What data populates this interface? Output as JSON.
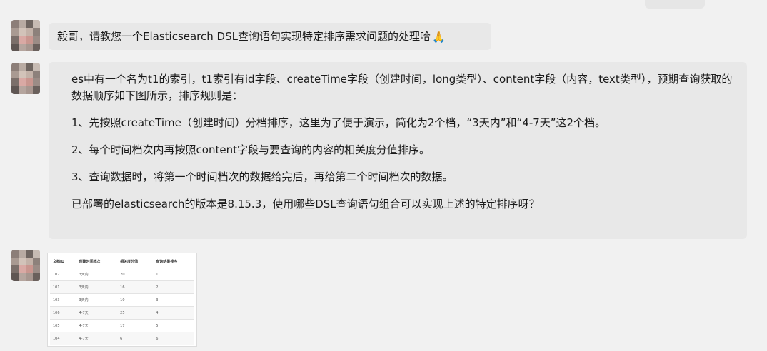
{
  "chat": {
    "msg1": {
      "text": "毅哥，请教您一个Elasticsearch DSL查询语句实现特定排序需求问题的处理哈",
      "emoji": "🙏"
    },
    "msg2": {
      "p1": "es中有一个名为t1的索引，t1索引有id字段、createTime字段（创建时间，long类型）、content字段（内容，text类型），预期查询获取的数据顺序如下图所示，排序规则是：",
      "p2": "1、先按照createTime（创建时间）分档排序，这里为了便于演示，简化为2个档，“3天内”和“4-7天”这2个档。",
      "p3": "2、每个时间档次内再按照content字段与要查询的内容的相关度分值排序。",
      "p4": "3、查询数据时，将第一个时间档次的数据给完后，再给第二个时间档次的数据。",
      "p5": "已部署的elasticsearch的版本是8.15.3，使用哪些DSL查询语句组合可以实现上述的特定排序呀？"
    },
    "msg3": {
      "table": {
        "headers": [
          "文档ID",
          "创建时间档次",
          "相关度分值",
          "查询结果排序"
        ],
        "rows": [
          [
            "102",
            "3天内",
            "20",
            "1"
          ],
          [
            "101",
            "3天内",
            "16",
            "2"
          ],
          [
            "103",
            "3天内",
            "10",
            "3"
          ],
          [
            "106",
            "4-7天",
            "25",
            "4"
          ],
          [
            "105",
            "4-7天",
            "17",
            "5"
          ],
          [
            "104",
            "4-7天",
            "6",
            "6"
          ]
        ]
      }
    }
  }
}
